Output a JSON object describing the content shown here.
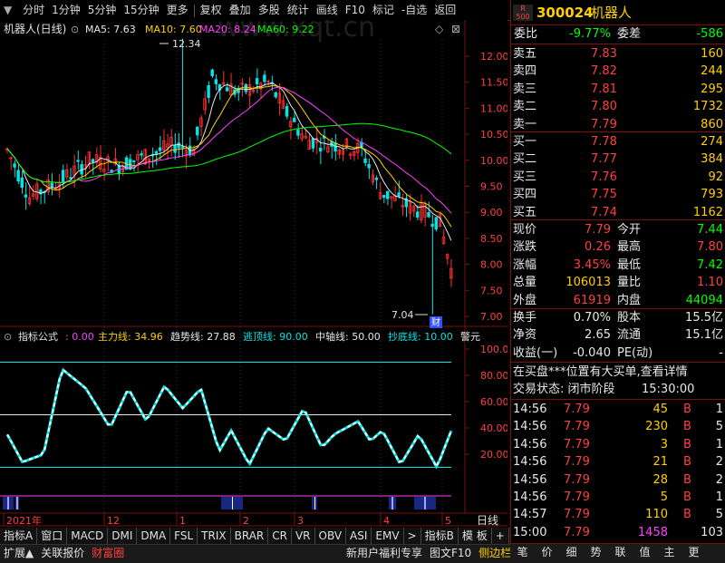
{
  "toolbar": {
    "menu_icon_label": "▼",
    "buttons": [
      "分时",
      "1分钟",
      "5分钟",
      "15分钟",
      "更多"
    ],
    "buttons2": [
      "复权",
      "叠加",
      "多股",
      "统计",
      "画线",
      "F10",
      "标记",
      "-自选",
      "返回"
    ]
  },
  "watermark": "www.xqt.cn",
  "main_header": {
    "stock": "机器人(日线)",
    "ma5": "MA5: 7.63",
    "ma10": "MA10: 7.60",
    "ma20": "MA20: 8.24",
    "ma60": "MA60: 9.22",
    "colors": {
      "ma5": "#e8e8e8",
      "ma10": "#ffd000",
      "ma20": "#ff40ff",
      "ma60": "#00ff00"
    }
  },
  "annotations": {
    "high": "12.34",
    "low": "7.04",
    "badge": "财"
  },
  "price_axis": {
    "ticks": [
      "12.00",
      "11.50",
      "11.00",
      "10.50",
      "10.00",
      "9.50",
      "9.00",
      "8.50",
      "8.00",
      "7.50",
      "7.00"
    ]
  },
  "indicator_header": {
    "name": "指标公式",
    "value": ": 0.00",
    "items": [
      {
        "label": "主力线: 34.96",
        "color": "#ffd000"
      },
      {
        "label": "趋势线: 27.88",
        "color": "#e8e8e8"
      },
      {
        "label": "逃顶线: 90.00",
        "color": "#00e5e5"
      },
      {
        "label": "中轴线: 50.00",
        "color": "#e8e8e8"
      },
      {
        "label": "抄底线: 10.00",
        "color": "#00e5e5"
      },
      {
        "label": "警元",
        "color": "#e8e8e8"
      }
    ]
  },
  "indicator_axis": {
    "ticks": [
      "100.00",
      "80.00",
      "60.00",
      "40.00",
      "20.00"
    ]
  },
  "time_axis": {
    "labels": [
      "2021年",
      "12",
      "1",
      "2",
      "3",
      "4",
      "5"
    ],
    "period": "日线"
  },
  "indicator_tabs": [
    "指标A",
    "窗口",
    "MACD",
    "DMI",
    "DMA",
    "FSL",
    "TRIX",
    "BRAR",
    "CR",
    "VR",
    "OBV",
    "ASI",
    "EMV",
    ">",
    "指标B",
    "模 板",
    "+",
    "-"
  ],
  "bottom_bar": [
    "扩展▲",
    "关联报价",
    "财富圈"
  ],
  "bottom_right": [
    "新用户福利专享",
    "图文F10",
    "侧边栏«"
  ],
  "right_panel": {
    "logo": "R 500",
    "code": "300024",
    "name": "机器人",
    "webi_label": "委比",
    "webi_value": "-9.77%",
    "weicha_label": "委差",
    "weicha_value": "-586",
    "asks": [
      {
        "label": "卖五",
        "price": "7.83",
        "vol": "160"
      },
      {
        "label": "卖四",
        "price": "7.82",
        "vol": "244"
      },
      {
        "label": "卖三",
        "price": "7.81",
        "vol": "295"
      },
      {
        "label": "卖二",
        "price": "7.80",
        "vol": "1732"
      },
      {
        "label": "卖一",
        "price": "7.79",
        "vol": "860"
      }
    ],
    "bids": [
      {
        "label": "买一",
        "price": "7.78",
        "vol": "274"
      },
      {
        "label": "买二",
        "price": "7.77",
        "vol": "384"
      },
      {
        "label": "买三",
        "price": "7.76",
        "vol": "92"
      },
      {
        "label": "买四",
        "price": "7.75",
        "vol": "793"
      },
      {
        "label": "买五",
        "price": "7.74",
        "vol": "1162"
      }
    ],
    "quote": [
      {
        "l1": "现价",
        "v1": "7.79",
        "c1": "red",
        "l2": "今开",
        "v2": "7.44",
        "c2": "grn"
      },
      {
        "l1": "涨跌",
        "v1": "0.26",
        "c1": "red",
        "l2": "最高",
        "v2": "7.80",
        "c2": "red"
      },
      {
        "l1": "涨幅",
        "v1": "3.45%",
        "c1": "red",
        "l2": "最低",
        "v2": "7.42",
        "c2": "grn"
      },
      {
        "l1": "总量",
        "v1": "106013",
        "c1": "yel",
        "l2": "量比",
        "v2": "1.10",
        "c2": "red"
      },
      {
        "l1": "外盘",
        "v1": "61919",
        "c1": "red",
        "l2": "内盘",
        "v2": "44094",
        "c2": "grn"
      }
    ],
    "quote2": [
      {
        "l1": "换手",
        "v1": "0.70%",
        "l2": "股本",
        "v2": "15.5亿"
      },
      {
        "l1": "净资",
        "v1": "2.65",
        "l2": "流通",
        "v2": "15.1亿"
      },
      {
        "l1": "收益(一)",
        "v1": "-0.040",
        "l2": "PE(动)",
        "v2": "-"
      }
    ],
    "notice": "在买盘***位置有大买单,查看详情",
    "status_label": "交易状态: 闭市阶段",
    "status_time": "15:30:00",
    "trades": [
      {
        "t": "14:56",
        "p": "7.79",
        "v": "45",
        "s": "B",
        "n": "1"
      },
      {
        "t": "14:56",
        "p": "7.79",
        "v": "230",
        "s": "B",
        "n": "5"
      },
      {
        "t": "14:56",
        "p": "7.79",
        "v": "3",
        "s": "B",
        "n": "1"
      },
      {
        "t": "14:56",
        "p": "7.79",
        "v": "21",
        "s": "B",
        "n": "2"
      },
      {
        "t": "14:56",
        "p": "7.79",
        "v": "28",
        "s": "B",
        "n": "2"
      },
      {
        "t": "14:56",
        "p": "7.79",
        "v": "5",
        "s": "B",
        "n": "1"
      },
      {
        "t": "14:57",
        "p": "7.79",
        "v": "110",
        "s": "B",
        "n": "5"
      },
      {
        "t": "15:00",
        "p": "7.79",
        "v": "1458",
        "s": "",
        "n": "103"
      }
    ],
    "bottom_tabs": [
      "笔",
      "价",
      "细",
      "势",
      "联",
      "值",
      "主",
      "更"
    ]
  }
}
